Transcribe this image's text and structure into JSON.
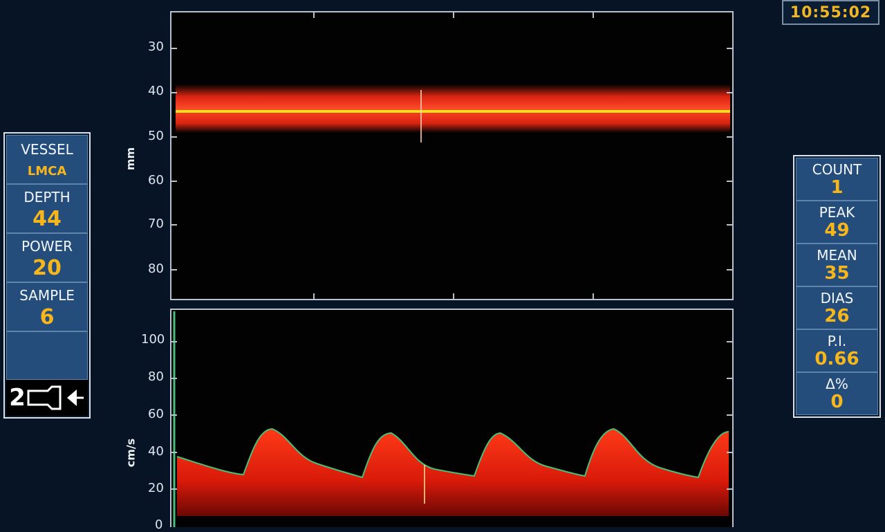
{
  "clock": "10:55:02",
  "left_panel": {
    "vessel_label": "VESSEL",
    "vessel_value": "LMCA",
    "depth_label": "DEPTH",
    "depth_value": "44",
    "power_label": "POWER",
    "power_value": "20",
    "sample_label": "SAMPLE",
    "sample_value": "6",
    "probe_number": "2"
  },
  "right_panel": {
    "count_label": "COUNT",
    "count_value": "1",
    "peak_label": "PEAK",
    "peak_value": "49",
    "mean_label": "MEAN",
    "mean_value": "35",
    "dias_label": "DIAS",
    "dias_value": "26",
    "pi_label": "P.I.",
    "pi_value": "0.66",
    "delta_label": "Δ%",
    "delta_value": "0"
  },
  "mmode": {
    "unit": "mm",
    "ticks": [
      "30",
      "40",
      "50",
      "60",
      "70",
      "80"
    ],
    "gate_depth": 44
  },
  "spectrum": {
    "unit": "cm/s",
    "ticks": [
      "0",
      "20",
      "40",
      "60",
      "80",
      "100"
    ]
  },
  "colors": {
    "value_accent": "#f6b61c",
    "panel_cell": "#244d7c",
    "signal": "#ff2a14",
    "gate_line": "#f2e21a",
    "envelope": "#46c07a"
  }
}
